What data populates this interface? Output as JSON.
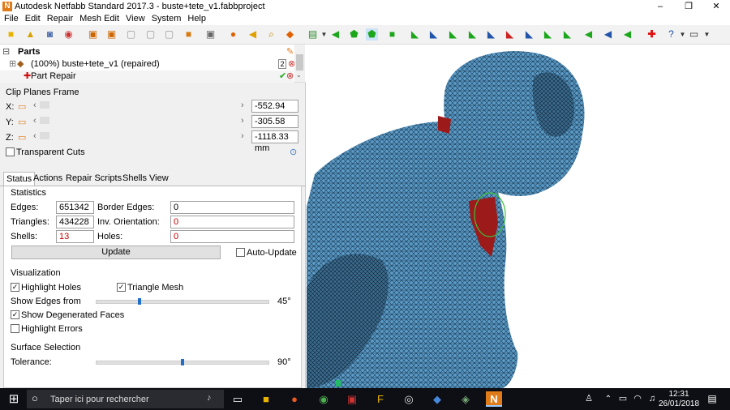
{
  "window": {
    "title": "Autodesk Netfabb Standard 2017.3 - buste+tete_v1.fabbproject",
    "logo_letter": "N",
    "controls": [
      "–",
      "❐",
      "✕"
    ]
  },
  "menu": [
    "File",
    "Edit",
    "Repair",
    "Mesh Edit",
    "View",
    "System",
    "Help"
  ],
  "tree": {
    "root_label": "Parts",
    "part_label": "(100%) buste+tete_v1 (repaired)",
    "part_badge": "2",
    "child_label": "Part Repair"
  },
  "clip_planes": {
    "title": "Clip Planes Frame",
    "rows": [
      {
        "axis": "X:",
        "value": "-552.94 mm"
      },
      {
        "axis": "Y:",
        "value": "-305.58 mm"
      },
      {
        "axis": "Z:",
        "value": "-1118.33 mm"
      }
    ],
    "transparent_cuts": "Transparent Cuts"
  },
  "tabs": [
    "Status",
    "Actions",
    "Repair Scripts",
    "Shells",
    "View"
  ],
  "statistics": {
    "title": "Statistics",
    "edges_label": "Edges:",
    "edges": "651342",
    "triangles_label": "Triangles:",
    "triangles": "434228",
    "shells_label": "Shells:",
    "shells": "13",
    "border_edges_label": "Border Edges:",
    "border_edges": "0",
    "inv_orientation_label": "Inv. Orientation:",
    "inv_orientation": "0",
    "holes_label": "Holes:",
    "holes": "0",
    "update_label": "Update",
    "auto_update_label": "Auto-Update",
    "auto_update_checked": false
  },
  "visualization": {
    "title": "Visualization",
    "highlight_holes": "Highlight Holes",
    "triangle_mesh": "Triangle Mesh",
    "show_edges_from": "Show Edges from",
    "edges_angle": "45°",
    "edges_slider_value": 0.25,
    "show_degenerated": "Show Degenerated Faces",
    "highlight_errors": "Highlight Errors"
  },
  "surface_selection": {
    "title": "Surface Selection",
    "tolerance_label": "Tolerance:",
    "tolerance_value": "90°",
    "tolerance_slider_value": 0.5
  },
  "taskbar": {
    "search_placeholder": "Taper ici pour rechercher",
    "time": "12:31",
    "date": "26/01/2018"
  },
  "colors": {
    "mesh_blue": "#4f8fbf",
    "error_red": "#9c1a1a",
    "accent_orange": "#e07b1a",
    "taskbar_bg": "#0e0f14",
    "highlight_green": "#3ac23a"
  }
}
